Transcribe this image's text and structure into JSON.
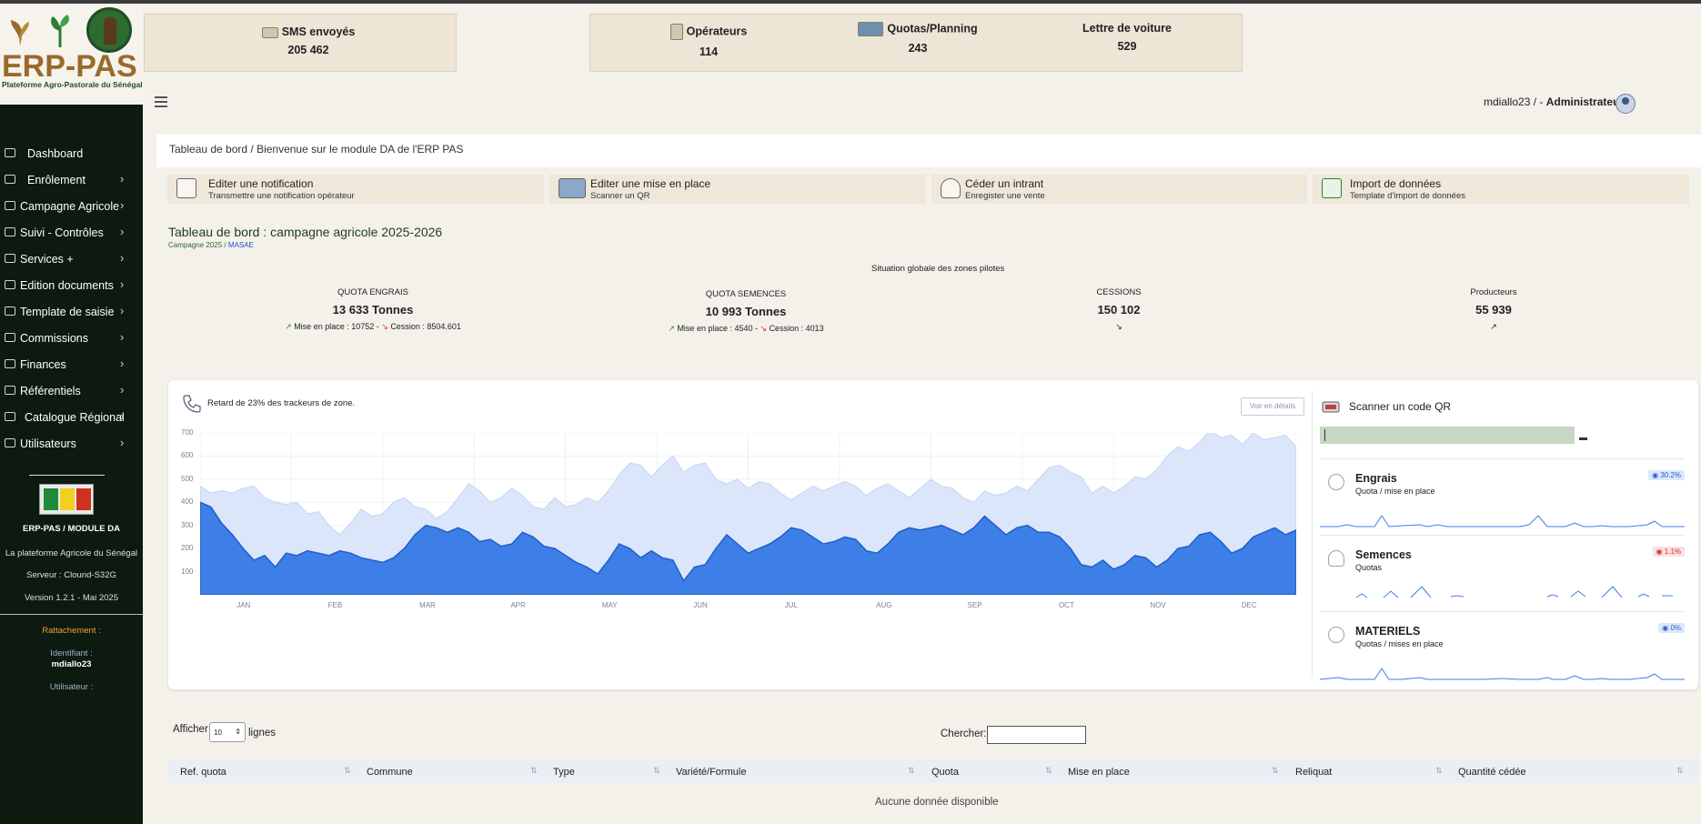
{
  "brand": {
    "name": "ERP-PAS",
    "tagline": "Plateforme Agro-Pastorale du Sénégal"
  },
  "colors": {
    "sidebar_bg": "#0c1a10",
    "accent_green": "#2a6b2a",
    "area_light": "#dbe6fa",
    "area_dark": "#3d7fe6",
    "qr_input": "#c5d8c2"
  },
  "top_stats": [
    {
      "label": "SMS envoyés",
      "value": "205 462",
      "icon": "sms-icon"
    },
    {
      "label": "Opérateurs",
      "value": "114",
      "icon": "operators-icon"
    },
    {
      "label": "Quotas/Planning",
      "value": "243",
      "icon": "truck-icon"
    },
    {
      "label": "Lettre de voiture",
      "value": "529",
      "icon": ""
    }
  ],
  "user": {
    "username": "mdiallo23",
    "separator": " / - ",
    "role": "Administrateur"
  },
  "sidebar": {
    "items": [
      {
        "label": "Dashboard",
        "icon": "dashboard-icon",
        "chevron": ""
      },
      {
        "label": "Enrôlement",
        "icon": "users-icon",
        "chevron": "›"
      },
      {
        "label": "Campagne Agricole",
        "icon": "campaign-icon",
        "chevron": "›"
      },
      {
        "label": "Suivi - Contrôles",
        "icon": "control-icon",
        "chevron": "›"
      },
      {
        "label": "Services +",
        "icon": "services-icon",
        "chevron": "›"
      },
      {
        "label": "Edition documents",
        "icon": "document-icon",
        "chevron": "›"
      },
      {
        "label": "Template de saisie",
        "icon": "template-icon",
        "chevron": "›"
      },
      {
        "label": "Commissions",
        "icon": "commissions-icon",
        "chevron": "›"
      },
      {
        "label": "Finances",
        "icon": "finances-icon",
        "chevron": "›"
      },
      {
        "label": "Référentiels",
        "icon": "search-icon",
        "chevron": "›"
      },
      {
        "label": "Catalogue Régional",
        "icon": "location-icon",
        "chevron": "›"
      },
      {
        "label": "Utilisateurs",
        "icon": "user-icon",
        "chevron": "›"
      }
    ],
    "module": "ERP-PAS / MODULE DA",
    "platform": "La plateforme Agricole du Sénégal",
    "server": "Serveur : Clound-S32G",
    "version": "Version 1.2.1 - Mai 2025",
    "attachment_label": "Rattachement :",
    "identifier_label": "Identifiant :",
    "identifier_value": "mdiallo23",
    "user_label": "Utilisateur :"
  },
  "breadcrumb": "Tableau de bord / Bienvenue sur le module DA de l'ERP PAS",
  "actions": [
    {
      "title": "Editer une notification",
      "subtitle": "Transmettre une notification opérateur",
      "icon": "notification-edit-icon"
    },
    {
      "title": "Editer une mise en place",
      "subtitle": "Scanner un QR",
      "icon": "truck-icon"
    },
    {
      "title": "Céder un intrant",
      "subtitle": "Enregister une vente",
      "icon": "money-bag-icon"
    },
    {
      "title": "Import de données",
      "subtitle": "Template d'import de données",
      "icon": "excel-icon"
    }
  ],
  "dashboard": {
    "title": "Tableau de bord : campagne agricole 2025-2026",
    "sub_campaign": "Campagne 2025",
    "sub_sep": "/",
    "sub_link": "MASAE",
    "situation": "Situation globale des zones pilotes"
  },
  "kpis": [
    {
      "title": "QUOTA ENGRAIS",
      "value": "13 633 Tonnes",
      "detail_a": "Mise en place : 10752",
      "detail_sep": " - ",
      "detail_b": "Cession : 8504.601"
    },
    {
      "title": "QUOTA SEMENCES",
      "value": "10 993 Tonnes",
      "detail_a": "Mise en place : 4540",
      "detail_sep": " - ",
      "detail_b": "Cession : 4013"
    },
    {
      "title": "CESSIONS",
      "value": "150 102"
    },
    {
      "title": "Producteurs",
      "value": "55 939"
    }
  ],
  "chart_card": {
    "alert": "Retard de 23% des trackeurs de zone.",
    "detail_button": "Voir en détails"
  },
  "chart_data": {
    "type": "area",
    "x": [
      "JAN",
      "FEB",
      "MAR",
      "APR",
      "MAY",
      "JUN",
      "JUL",
      "AUG",
      "SEP",
      "OCT",
      "NOV",
      "DEC"
    ],
    "ylim": [
      0,
      700
    ],
    "yticks": [
      700,
      600,
      500,
      400,
      300,
      200,
      100
    ],
    "grid": true,
    "series": [
      {
        "name": "",
        "values": [
          470,
          440,
          450,
          440,
          460,
          470,
          420,
          400,
          390,
          400,
          350,
          360,
          300,
          260,
          310,
          370,
          340,
          350,
          400,
          420,
          380,
          370,
          330,
          360,
          420,
          480,
          450,
          400,
          420,
          460,
          430,
          380,
          370,
          420,
          380,
          390,
          420,
          400,
          450,
          520,
          570,
          560,
          510,
          560,
          600,
          530,
          560,
          570,
          500,
          480,
          500,
          460,
          490,
          480,
          440,
          410,
          440,
          470,
          450,
          470,
          490,
          470,
          430,
          460,
          480,
          450,
          420,
          460,
          500,
          470,
          460,
          420,
          400,
          450,
          430,
          440,
          470,
          450,
          500,
          550,
          560,
          530,
          510,
          440,
          470,
          440,
          470,
          510,
          500,
          540,
          600,
          640,
          620,
          660,
          710,
          680,
          690,
          650,
          700,
          670,
          680,
          690,
          640
        ]
      },
      {
        "name": "",
        "values": [
          400,
          380,
          310,
          260,
          200,
          150,
          170,
          120,
          180,
          170,
          190,
          180,
          170,
          190,
          180,
          160,
          150,
          140,
          160,
          200,
          260,
          300,
          290,
          270,
          290,
          270,
          230,
          240,
          210,
          220,
          270,
          250,
          210,
          200,
          170,
          140,
          120,
          90,
          150,
          220,
          200,
          160,
          190,
          160,
          150,
          60,
          120,
          130,
          200,
          260,
          220,
          180,
          200,
          220,
          250,
          290,
          280,
          250,
          220,
          230,
          250,
          240,
          190,
          180,
          220,
          270,
          290,
          280,
          290,
          300,
          280,
          260,
          290,
          340,
          300,
          260,
          290,
          300,
          270,
          270,
          250,
          200,
          130,
          120,
          150,
          110,
          130,
          170,
          160,
          120,
          150,
          200,
          210,
          260,
          270,
          230,
          180,
          200,
          250,
          270,
          290,
          260,
          280
        ]
      }
    ]
  },
  "qr": {
    "title": "Scanner un code QR"
  },
  "metrics": [
    {
      "title": "Engrais",
      "subtitle": "Quota / mise en place",
      "badge": "30.2%",
      "badge_color": "blue",
      "icon": "smile-icon"
    },
    {
      "title": "Semences",
      "subtitle": "Quotas",
      "badge": "1.1%",
      "badge_color": "red",
      "icon": "person-icon"
    },
    {
      "title": "MATERIELS",
      "subtitle": "Quotas / mises en place",
      "badge": "0%",
      "badge_color": "blue",
      "icon": "registered-icon"
    }
  ],
  "table": {
    "show_label": "Afficher",
    "page_length": "10",
    "lines_label": "lignes",
    "search_label": "Chercher:",
    "columns": [
      "Ref. quota",
      "Commune",
      "Type",
      "Variété/Formule",
      "Quota",
      "Mise en place",
      "Reliquat",
      "Quantité cédée"
    ],
    "empty": "Aucune donnée disponible"
  }
}
